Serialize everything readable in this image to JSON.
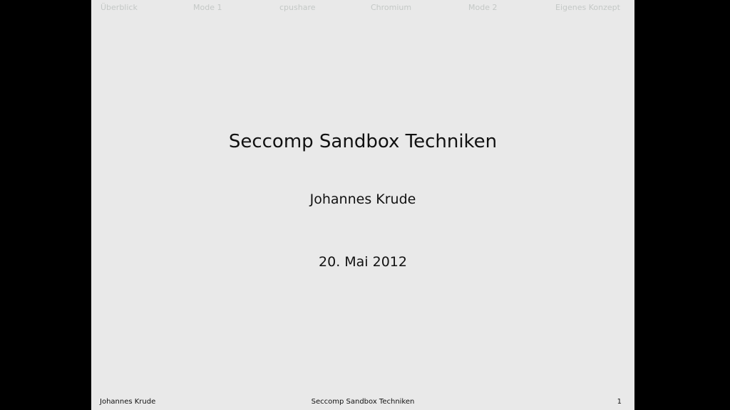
{
  "nav": {
    "items": [
      "Überblick",
      "Mode 1",
      "cpushare",
      "Chromium",
      "Mode 2",
      "Eigenes Konzept"
    ]
  },
  "slide": {
    "title": "Seccomp Sandbox Techniken",
    "author": "Johannes Krude",
    "date": "20. Mai 2012"
  },
  "footer": {
    "author": "Johannes Krude",
    "title": "Seccomp Sandbox Techniken",
    "page_number": "1"
  },
  "colors": {
    "background": "#000000",
    "slide": "#e9e9e9",
    "nav_text": "#c4c8c6",
    "text": "#111111"
  }
}
